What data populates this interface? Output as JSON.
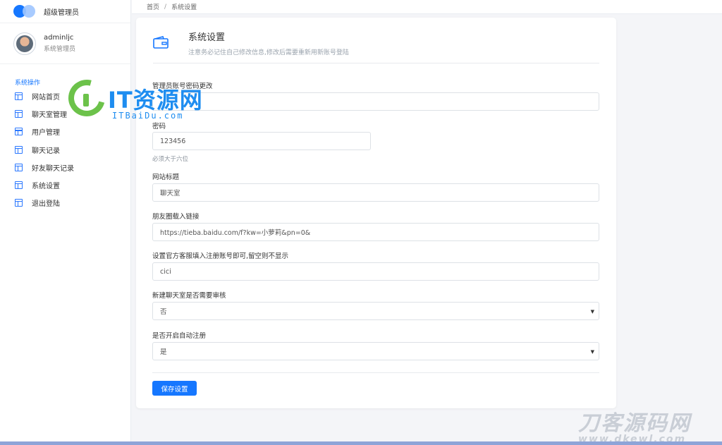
{
  "brand": {
    "name": "超级管理员",
    "primary_color": "#1677ff"
  },
  "user": {
    "name": "adminljc",
    "role": "系统管理员"
  },
  "sidebar": {
    "section_title": "系统操作",
    "items": [
      {
        "label": "网站首页",
        "icon": "layout-icon"
      },
      {
        "label": "聊天室管理",
        "icon": "layout-icon"
      },
      {
        "label": "用户管理",
        "icon": "layout-icon"
      },
      {
        "label": "聊天记录",
        "icon": "layout-icon"
      },
      {
        "label": "好友聊天记录",
        "icon": "layout-icon"
      },
      {
        "label": "系统设置",
        "icon": "layout-icon"
      },
      {
        "label": "退出登陆",
        "icon": "layout-icon"
      }
    ]
  },
  "breadcrumb": {
    "home": "首页",
    "separator": "/",
    "current": "系统设置"
  },
  "page": {
    "title": "系统设置",
    "subtitle": "注意务必记住自己修改信息,修改后需要重新用新账号登陆"
  },
  "form": {
    "account": {
      "label": "管理员账号密码更改",
      "value": ""
    },
    "password": {
      "label": "密码",
      "value": "123456",
      "help": "必须大于六位"
    },
    "site_title": {
      "label": "网站标题",
      "value": "聊天室"
    },
    "moments_link": {
      "label": "朋友圈载入链接",
      "value": "https://tieba.baidu.com/f?kw=小萝莉&pn=0&"
    },
    "service": {
      "label": "设置官方客服填入注册账号即可,留空则不显示",
      "value": "cici"
    },
    "review": {
      "label": "新建聊天室是否需要审核",
      "value": "否"
    },
    "auto_register": {
      "label": "是否开启自动注册",
      "value": "是"
    },
    "save_label": "保存设置"
  },
  "watermarks": {
    "it_title": "IT资源网",
    "it_url": "ITBaiDu.com",
    "dk_title": "刀客源码网",
    "dk_url": "www.dkewl.com"
  }
}
